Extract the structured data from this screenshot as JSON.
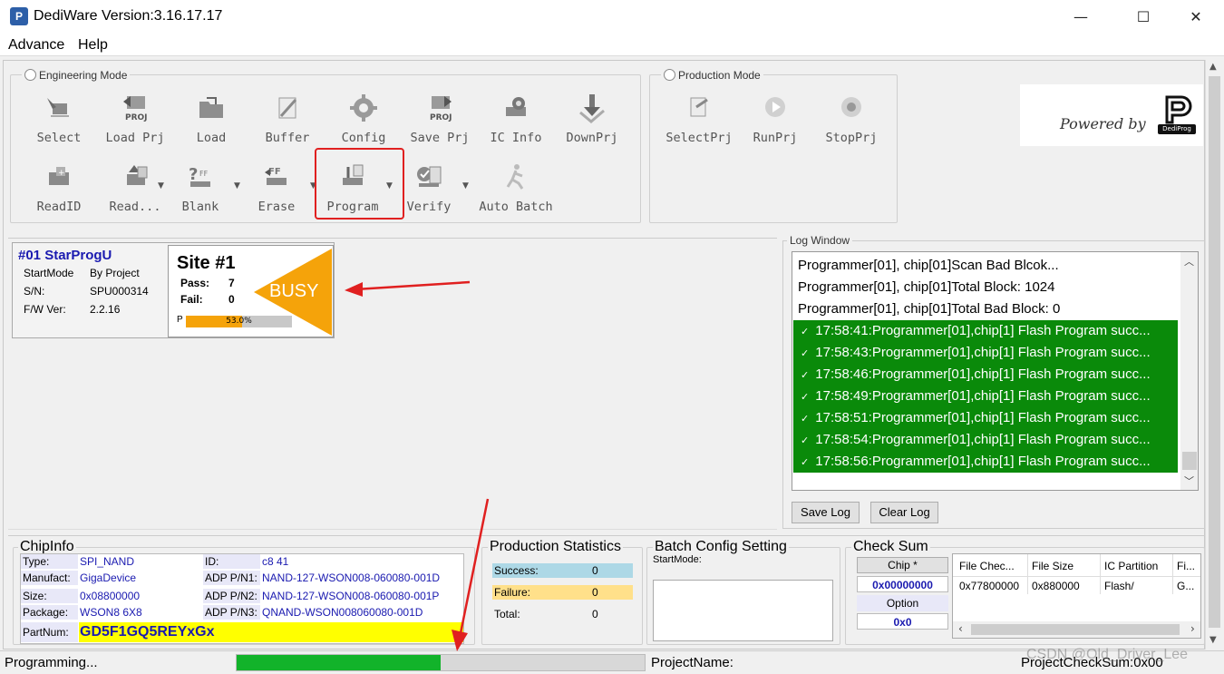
{
  "window": {
    "title": "DediWare  Version:3.16.17.17",
    "app_icon": "P",
    "minimize": "—",
    "maximize": "☐",
    "close": "✕"
  },
  "menu": [
    "Advance",
    "Help"
  ],
  "engineering": {
    "mode_label": "Engineering Mode",
    "row1": [
      "Select",
      "Load Prj",
      "Load",
      "Buffer",
      "Config",
      "Save Prj",
      "IC Info",
      "DownPrj"
    ],
    "row2": [
      "ReadID",
      "Read...",
      "Blank",
      "Erase",
      "Program",
      "Verify",
      "Auto Batch"
    ]
  },
  "production": {
    "mode_label": "Production Mode",
    "buttons": [
      "SelectPrj",
      "RunPrj",
      "StopPrj"
    ]
  },
  "branding": {
    "powered_by": "Powered by",
    "logo_text": "DediProg"
  },
  "programmer": {
    "name": "#01 StarProgU",
    "startmode_label": "StartMode",
    "startmode_value": "By Project",
    "sn_label": "S/N:",
    "sn_value": "SPU000314",
    "fw_label": "F/W Ver:",
    "fw_value": "2.2.16"
  },
  "site": {
    "title": "Site #1",
    "pass_label": "Pass:",
    "pass_value": "7",
    "fail_label": "Fail:",
    "fail_value": "0",
    "status": "BUSY",
    "progress_label": "P",
    "progress_text": "53.0%",
    "progress": 0.53
  },
  "log": {
    "title": "Log Window",
    "lines": [
      {
        "text": "Programmer[01], chip[01]Scan Bad Blcok...",
        "ok": false
      },
      {
        "text": "Programmer[01], chip[01]Total Block: 1024",
        "ok": false
      },
      {
        "text": "Programmer[01], chip[01]Total Bad Block: 0",
        "ok": false
      },
      {
        "text": "17:58:41:Programmer[01],chip[1] Flash Program succ...",
        "ok": true
      },
      {
        "text": "17:58:43:Programmer[01],chip[1] Flash Program succ...",
        "ok": true
      },
      {
        "text": "17:58:46:Programmer[01],chip[1] Flash Program succ...",
        "ok": true
      },
      {
        "text": "17:58:49:Programmer[01],chip[1] Flash Program succ...",
        "ok": true
      },
      {
        "text": "17:58:51:Programmer[01],chip[1] Flash Program succ...",
        "ok": true
      },
      {
        "text": "17:58:54:Programmer[01],chip[1] Flash Program succ...",
        "ok": true
      },
      {
        "text": "17:58:56:Programmer[01],chip[1] Flash Program succ...",
        "ok": true
      }
    ],
    "save_btn": "Save Log",
    "clear_btn": "Clear Log"
  },
  "chipinfo": {
    "title": "ChipInfo",
    "type_label": "Type:",
    "type_value": "SPI_NAND",
    "manuf_label": "Manufact:",
    "manuf_value": "GigaDevice",
    "size_label": "Size:",
    "size_value": "0x08800000",
    "package_label": "Package:",
    "package_value": "WSON8 6X8",
    "id_label": "ID:",
    "id_value": "c8 41",
    "pn1_label": "ADP P/N1:",
    "pn1_value": "NAND-127-WSON008-060080-001D",
    "pn2_label": "ADP P/N2:",
    "pn2_value": "NAND-127-WSON008-060080-001P",
    "pn3_label": "ADP P/N3:",
    "pn3_value": "QNAND-WSON008060080-001D",
    "partnum_label": "PartNum:",
    "partnum_value": "GD5F1GQ5REYxGx"
  },
  "stats": {
    "title": "Production Statistics",
    "success_label": "Success:",
    "success_value": "0",
    "failure_label": "Failure:",
    "failure_value": "0",
    "total_label": "Total:",
    "total_value": "0"
  },
  "batch": {
    "title": "Batch Config Setting",
    "startmode_label": "StartMode:"
  },
  "checksum": {
    "title": "Check Sum",
    "chip_btn": "Chip *",
    "chip_value": "0x00000000",
    "option_btn": "Option",
    "option_value": "0x0",
    "columns": [
      "File Chec...",
      "File Size",
      "IC Partition",
      "Fi..."
    ],
    "row": [
      "0x77800000",
      "0x880000",
      "Flash/",
      "G..."
    ]
  },
  "status": {
    "text": "Programming...",
    "progress": 0.5,
    "project_name_label": "ProjectName:",
    "project_checksum": "ProjectCheckSum:0x00"
  },
  "watermark": "CSDN @Old_Driver_Lee",
  "colors": {
    "busy": "#f5a30a",
    "log_ok": "#0a8a0a",
    "partnum_bg": "#ffff00",
    "highlight": "#e02020",
    "progress_green": "#12b32a"
  }
}
